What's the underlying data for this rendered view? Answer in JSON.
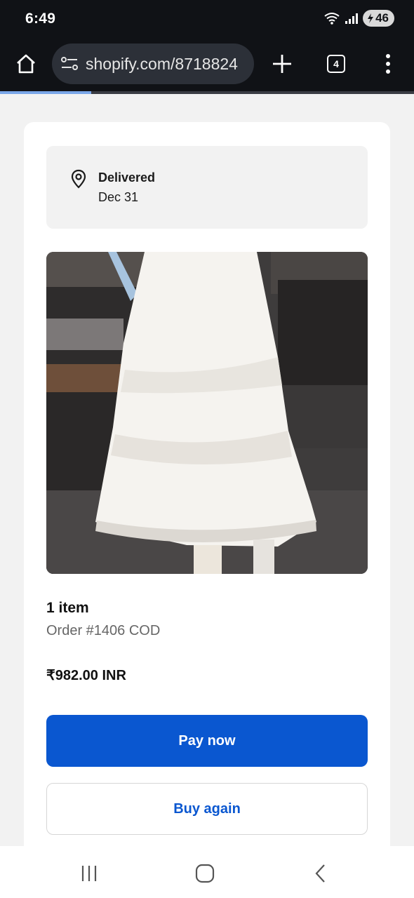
{
  "status_bar": {
    "time": "6:49",
    "battery": "46"
  },
  "browser": {
    "url": "shopify.com/8718824",
    "tab_count": "4",
    "load_progress": 0.22
  },
  "order": {
    "delivery_status": "Delivered",
    "delivery_date": "Dec 31",
    "item_count": "1 item",
    "order_number": "Order #1406 COD",
    "total": "₹982.00 INR",
    "pay_label": "Pay now",
    "buy_again_label": "Buy again"
  },
  "colors": {
    "accent": "#0a57d0",
    "toolbar": "#101216",
    "page_bg": "#f2f2f2"
  },
  "icons": {
    "home": "home-icon",
    "site_settings": "site-settings-icon",
    "new_tab": "plus-icon",
    "menu": "more-vertical-icon",
    "location": "location-pin-icon",
    "nav_recent": "recent-apps-icon",
    "nav_home": "nav-home-icon",
    "nav_back": "back-icon"
  }
}
